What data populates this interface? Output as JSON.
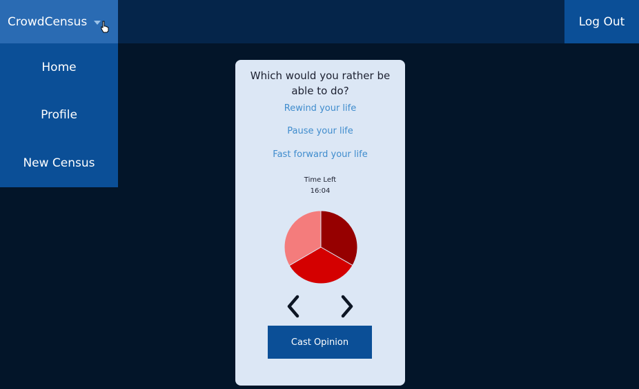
{
  "header": {
    "brand": "CrowdCensus",
    "logout_label": "Log Out"
  },
  "menu": {
    "items": [
      {
        "label": "Home"
      },
      {
        "label": "Profile"
      },
      {
        "label": "New Census"
      }
    ]
  },
  "poll": {
    "question": "Which would you rather be able to do?",
    "options": [
      "Rewind your life",
      "Pause your life",
      "Fast forward your life"
    ],
    "timer_label": "Time Left",
    "timer_value": "16:04",
    "cast_label": "Cast Opinion"
  },
  "chart_data": {
    "type": "pie",
    "values": [
      33.3,
      33.3,
      33.4
    ],
    "colors": [
      "#960000",
      "#d40000",
      "#f47c7c"
    ]
  },
  "colors": {
    "background": "#031529",
    "topbar": "#05254a",
    "brand": "#2a6bb3",
    "accent": "#0b4f97",
    "card": "#dce7f5",
    "link": "#3f8ccd"
  },
  "icons": {
    "brand_caret": "chevron-down-icon",
    "prev": "chevron-left-icon",
    "next": "chevron-right-icon"
  }
}
